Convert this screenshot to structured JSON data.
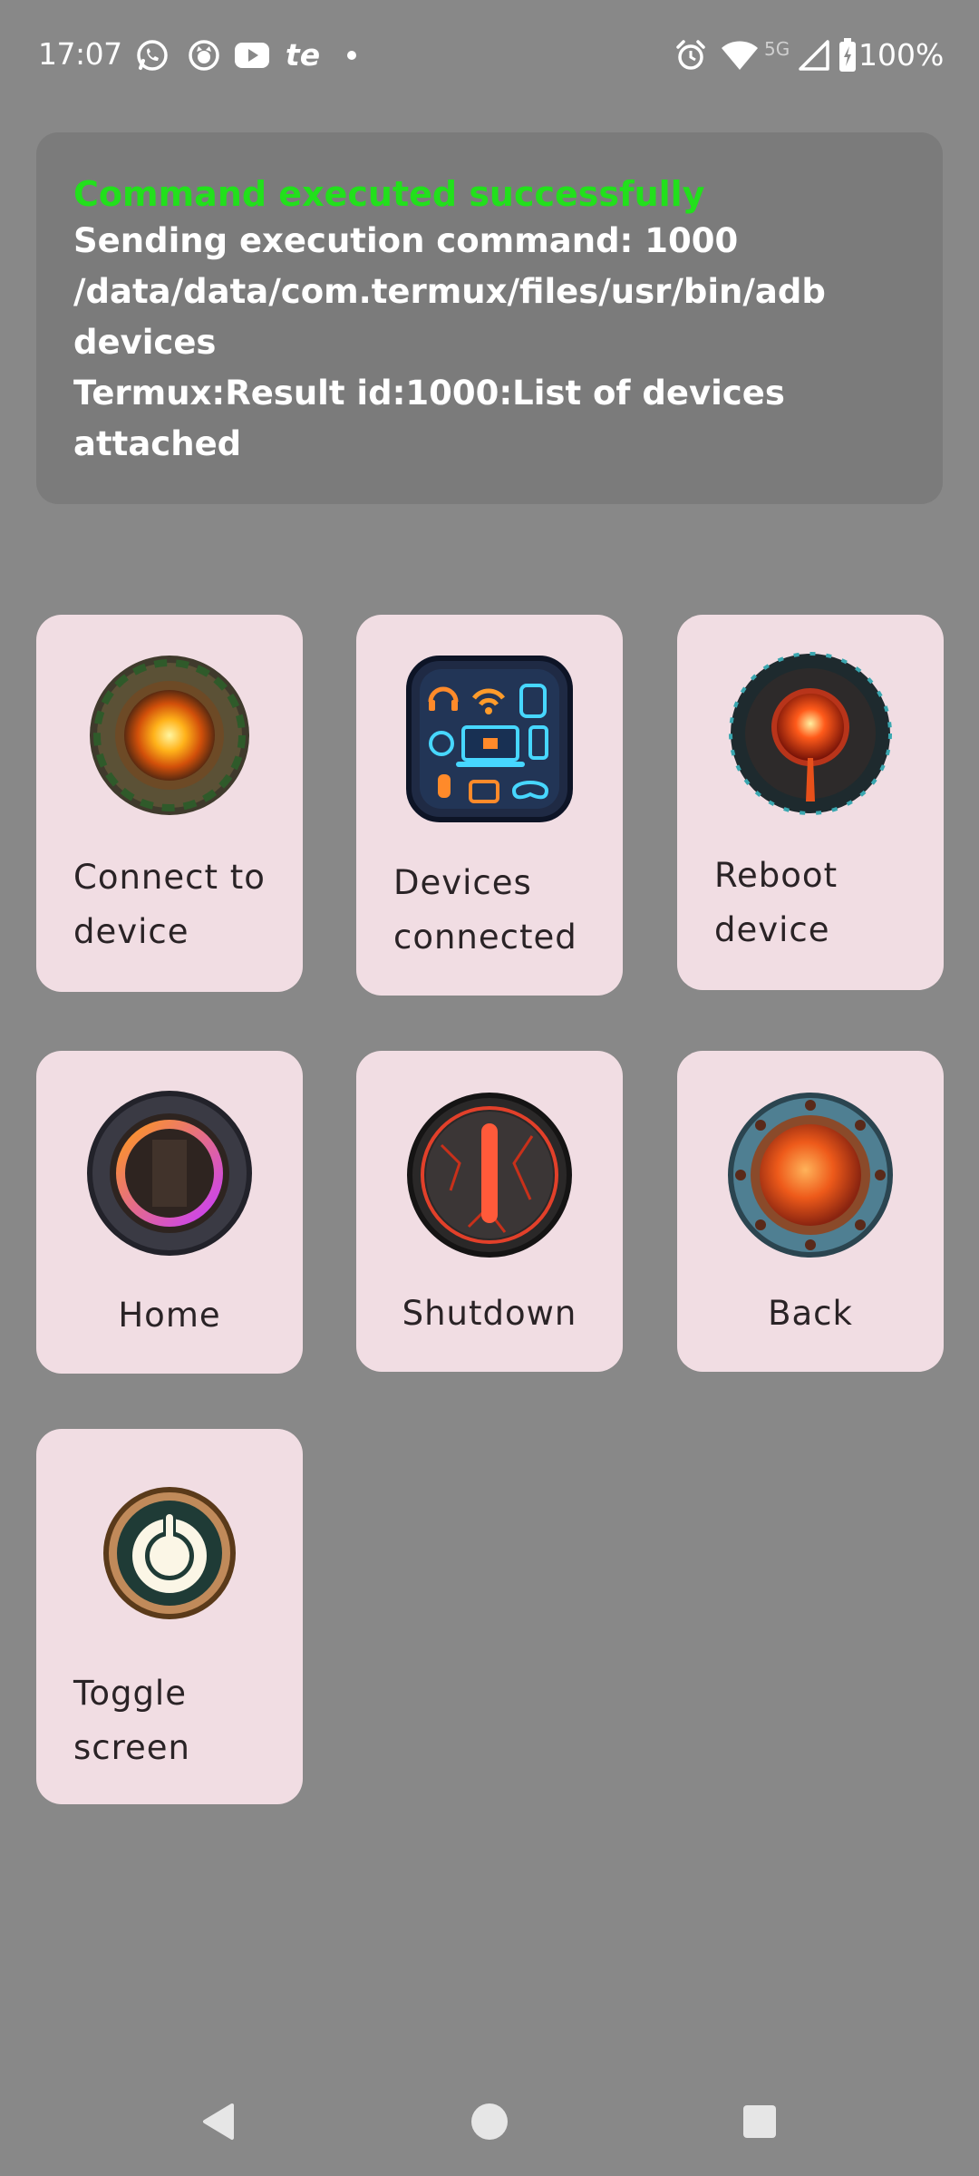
{
  "status_bar": {
    "time": "17:07",
    "notification_icons": [
      "whatsapp-icon",
      "termux-cat-icon",
      "youtube-icon",
      "te-app-icon",
      "more-dot-icon"
    ],
    "te_label": "te",
    "system_icons": [
      "alarm-icon",
      "wifi-icon",
      "cell-signal-icon",
      "battery-charging-icon"
    ],
    "network_type": "5G",
    "battery_percent": "100%"
  },
  "output": {
    "success_message": "Command executed successfully",
    "log_text": "Sending execution command: 1000 /data/data/com.termux/files/usr/bin/adb devices\nTermux:Result id:1000:List of devices attached",
    "success_color": "#22e01c",
    "background_color": "#7b7b7b"
  },
  "actions": [
    {
      "id": "connect",
      "label": "Connect to device",
      "icon": "orb-connect-icon"
    },
    {
      "id": "devices",
      "label": "Devices connected",
      "icon": "devices-gadgets-icon"
    },
    {
      "id": "reboot",
      "label": "Reboot device",
      "icon": "reboot-orb-icon"
    },
    {
      "id": "home",
      "label": "Home",
      "icon": "home-ring-icon"
    },
    {
      "id": "shutdown",
      "label": "Shutdown",
      "icon": "shutdown-orb-icon"
    },
    {
      "id": "back",
      "label": "Back",
      "icon": "back-porthole-icon"
    },
    {
      "id": "toggle",
      "label": "Toggle screen",
      "icon": "power-toggle-icon"
    }
  ],
  "card_color": "#f1dde3",
  "navigation_bar": {
    "buttons": [
      "back-triangle",
      "home-circle",
      "recents-square"
    ]
  }
}
